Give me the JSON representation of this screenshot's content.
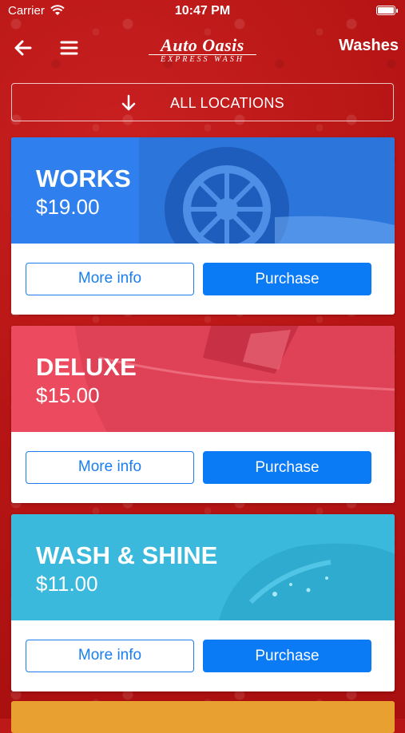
{
  "status_bar": {
    "carrier": "Carrier",
    "time": "10:47 PM"
  },
  "nav": {
    "brand_main": "Auto Oasis",
    "brand_sub": "EXPRESS WASH",
    "title": "Washes"
  },
  "locations": {
    "label": "ALL LOCATIONS"
  },
  "buttons": {
    "more_info": "More info",
    "purchase": "Purchase"
  },
  "washes": [
    {
      "name": "WORKS",
      "price": "$19.00",
      "color": "#2f80ee"
    },
    {
      "name": "DELUXE",
      "price": "$15.00",
      "color": "#ec4a5e"
    },
    {
      "name": "WASH & SHINE",
      "price": "$11.00",
      "color": "#3ab9dd"
    }
  ],
  "next_card_color": "#e8a030",
  "colors": {
    "background": "#b71515",
    "accent": "#0a7af5"
  }
}
